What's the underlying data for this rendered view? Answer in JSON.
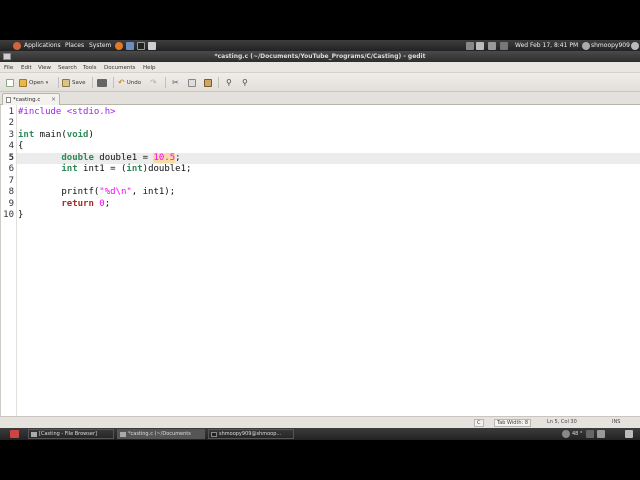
{
  "top_panel": {
    "applications": "Applications",
    "places": "Places",
    "system": "System",
    "datetime": "Wed Feb 17,  8:41 PM",
    "user": "shmoopy909"
  },
  "window": {
    "title": "*casting.c (~/Documents/YouTube_Programs/C/Casting) - gedit"
  },
  "menubar": [
    "File",
    "Edit",
    "View",
    "Search",
    "Tools",
    "Documents",
    "Help"
  ],
  "toolbar": {
    "open": "Open",
    "save": "Save",
    "undo": "Undo"
  },
  "tab": {
    "label": "*casting.c",
    "close": "×"
  },
  "editor": {
    "current_line": 5,
    "line_numbers": [
      "1",
      "2",
      "3",
      "4",
      "5",
      "6",
      "7",
      "8",
      "9",
      "10"
    ],
    "lines": [
      "#include <stdio.h>",
      "",
      "int main(void)",
      "{",
      "        double double1 = 10.5;",
      "        int int1 = (int)double1;",
      "",
      "        printf(\"%d\\n\", int1);",
      "        return 0;",
      "}"
    ]
  },
  "statusbar": {
    "language": "C",
    "tab_width": "Tab Width: 8",
    "position": "Ln 5, Col 30",
    "mode": "INS"
  },
  "taskbar": {
    "items": [
      "[Casting - File Browser]",
      "*casting.c (~/Documents",
      "shmoopy909@shmoop..."
    ],
    "volume": "48 °"
  },
  "colors": {
    "type_keyword": "#2e8b57",
    "keyword": "#a52a2a",
    "preprocessor": "#a020f0",
    "string_number": "#ff00ff",
    "bracket_highlight": "#f8d9a8"
  }
}
